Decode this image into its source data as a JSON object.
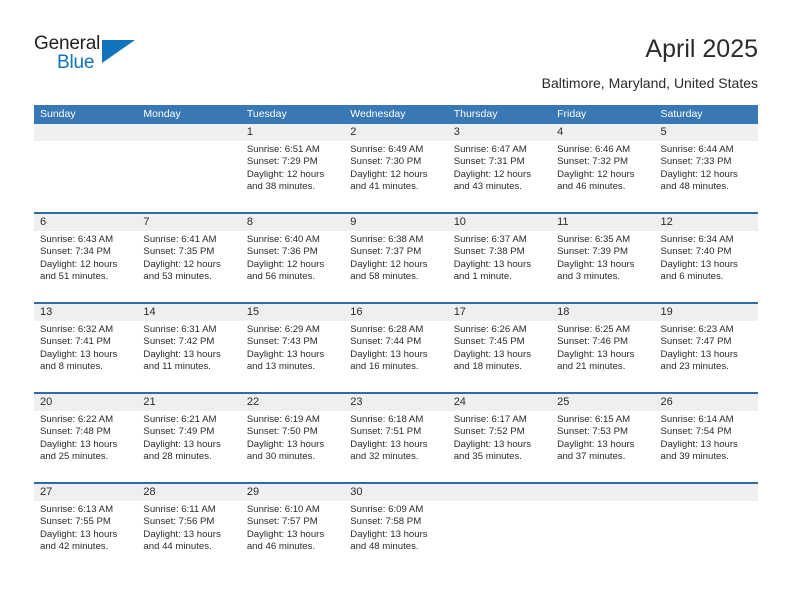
{
  "brand": {
    "name_part1": "General",
    "name_part2": "Blue",
    "accent_color": "#1273bd",
    "logo_icon": "triangle-logo-icon"
  },
  "header": {
    "title": "April 2025",
    "subtitle": "Baltimore, Maryland, United States"
  },
  "calendar": {
    "header_color": "#3878b4",
    "row_divider_color": "#2b6cab",
    "day_band_color": "#efefef",
    "weekdays": [
      "Sunday",
      "Monday",
      "Tuesday",
      "Wednesday",
      "Thursday",
      "Friday",
      "Saturday"
    ],
    "weeks": [
      [
        {
          "day": "",
          "empty": true,
          "sunrise": "",
          "sunset": "",
          "daylight_line1": "",
          "daylight_line2": ""
        },
        {
          "day": "",
          "empty": true,
          "sunrise": "",
          "sunset": "",
          "daylight_line1": "",
          "daylight_line2": ""
        },
        {
          "day": "1",
          "empty": false,
          "sunrise": "Sunrise: 6:51 AM",
          "sunset": "Sunset: 7:29 PM",
          "daylight_line1": "Daylight: 12 hours",
          "daylight_line2": "and 38 minutes."
        },
        {
          "day": "2",
          "empty": false,
          "sunrise": "Sunrise: 6:49 AM",
          "sunset": "Sunset: 7:30 PM",
          "daylight_line1": "Daylight: 12 hours",
          "daylight_line2": "and 41 minutes."
        },
        {
          "day": "3",
          "empty": false,
          "sunrise": "Sunrise: 6:47 AM",
          "sunset": "Sunset: 7:31 PM",
          "daylight_line1": "Daylight: 12 hours",
          "daylight_line2": "and 43 minutes."
        },
        {
          "day": "4",
          "empty": false,
          "sunrise": "Sunrise: 6:46 AM",
          "sunset": "Sunset: 7:32 PM",
          "daylight_line1": "Daylight: 12 hours",
          "daylight_line2": "and 46 minutes."
        },
        {
          "day": "5",
          "empty": false,
          "sunrise": "Sunrise: 6:44 AM",
          "sunset": "Sunset: 7:33 PM",
          "daylight_line1": "Daylight: 12 hours",
          "daylight_line2": "and 48 minutes."
        }
      ],
      [
        {
          "day": "6",
          "empty": false,
          "sunrise": "Sunrise: 6:43 AM",
          "sunset": "Sunset: 7:34 PM",
          "daylight_line1": "Daylight: 12 hours",
          "daylight_line2": "and 51 minutes."
        },
        {
          "day": "7",
          "empty": false,
          "sunrise": "Sunrise: 6:41 AM",
          "sunset": "Sunset: 7:35 PM",
          "daylight_line1": "Daylight: 12 hours",
          "daylight_line2": "and 53 minutes."
        },
        {
          "day": "8",
          "empty": false,
          "sunrise": "Sunrise: 6:40 AM",
          "sunset": "Sunset: 7:36 PM",
          "daylight_line1": "Daylight: 12 hours",
          "daylight_line2": "and 56 minutes."
        },
        {
          "day": "9",
          "empty": false,
          "sunrise": "Sunrise: 6:38 AM",
          "sunset": "Sunset: 7:37 PM",
          "daylight_line1": "Daylight: 12 hours",
          "daylight_line2": "and 58 minutes."
        },
        {
          "day": "10",
          "empty": false,
          "sunrise": "Sunrise: 6:37 AM",
          "sunset": "Sunset: 7:38 PM",
          "daylight_line1": "Daylight: 13 hours",
          "daylight_line2": "and 1 minute."
        },
        {
          "day": "11",
          "empty": false,
          "sunrise": "Sunrise: 6:35 AM",
          "sunset": "Sunset: 7:39 PM",
          "daylight_line1": "Daylight: 13 hours",
          "daylight_line2": "and 3 minutes."
        },
        {
          "day": "12",
          "empty": false,
          "sunrise": "Sunrise: 6:34 AM",
          "sunset": "Sunset: 7:40 PM",
          "daylight_line1": "Daylight: 13 hours",
          "daylight_line2": "and 6 minutes."
        }
      ],
      [
        {
          "day": "13",
          "empty": false,
          "sunrise": "Sunrise: 6:32 AM",
          "sunset": "Sunset: 7:41 PM",
          "daylight_line1": "Daylight: 13 hours",
          "daylight_line2": "and 8 minutes."
        },
        {
          "day": "14",
          "empty": false,
          "sunrise": "Sunrise: 6:31 AM",
          "sunset": "Sunset: 7:42 PM",
          "daylight_line1": "Daylight: 13 hours",
          "daylight_line2": "and 11 minutes."
        },
        {
          "day": "15",
          "empty": false,
          "sunrise": "Sunrise: 6:29 AM",
          "sunset": "Sunset: 7:43 PM",
          "daylight_line1": "Daylight: 13 hours",
          "daylight_line2": "and 13 minutes."
        },
        {
          "day": "16",
          "empty": false,
          "sunrise": "Sunrise: 6:28 AM",
          "sunset": "Sunset: 7:44 PM",
          "daylight_line1": "Daylight: 13 hours",
          "daylight_line2": "and 16 minutes."
        },
        {
          "day": "17",
          "empty": false,
          "sunrise": "Sunrise: 6:26 AM",
          "sunset": "Sunset: 7:45 PM",
          "daylight_line1": "Daylight: 13 hours",
          "daylight_line2": "and 18 minutes."
        },
        {
          "day": "18",
          "empty": false,
          "sunrise": "Sunrise: 6:25 AM",
          "sunset": "Sunset: 7:46 PM",
          "daylight_line1": "Daylight: 13 hours",
          "daylight_line2": "and 21 minutes."
        },
        {
          "day": "19",
          "empty": false,
          "sunrise": "Sunrise: 6:23 AM",
          "sunset": "Sunset: 7:47 PM",
          "daylight_line1": "Daylight: 13 hours",
          "daylight_line2": "and 23 minutes."
        }
      ],
      [
        {
          "day": "20",
          "empty": false,
          "sunrise": "Sunrise: 6:22 AM",
          "sunset": "Sunset: 7:48 PM",
          "daylight_line1": "Daylight: 13 hours",
          "daylight_line2": "and 25 minutes."
        },
        {
          "day": "21",
          "empty": false,
          "sunrise": "Sunrise: 6:21 AM",
          "sunset": "Sunset: 7:49 PM",
          "daylight_line1": "Daylight: 13 hours",
          "daylight_line2": "and 28 minutes."
        },
        {
          "day": "22",
          "empty": false,
          "sunrise": "Sunrise: 6:19 AM",
          "sunset": "Sunset: 7:50 PM",
          "daylight_line1": "Daylight: 13 hours",
          "daylight_line2": "and 30 minutes."
        },
        {
          "day": "23",
          "empty": false,
          "sunrise": "Sunrise: 6:18 AM",
          "sunset": "Sunset: 7:51 PM",
          "daylight_line1": "Daylight: 13 hours",
          "daylight_line2": "and 32 minutes."
        },
        {
          "day": "24",
          "empty": false,
          "sunrise": "Sunrise: 6:17 AM",
          "sunset": "Sunset: 7:52 PM",
          "daylight_line1": "Daylight: 13 hours",
          "daylight_line2": "and 35 minutes."
        },
        {
          "day": "25",
          "empty": false,
          "sunrise": "Sunrise: 6:15 AM",
          "sunset": "Sunset: 7:53 PM",
          "daylight_line1": "Daylight: 13 hours",
          "daylight_line2": "and 37 minutes."
        },
        {
          "day": "26",
          "empty": false,
          "sunrise": "Sunrise: 6:14 AM",
          "sunset": "Sunset: 7:54 PM",
          "daylight_line1": "Daylight: 13 hours",
          "daylight_line2": "and 39 minutes."
        }
      ],
      [
        {
          "day": "27",
          "empty": false,
          "sunrise": "Sunrise: 6:13 AM",
          "sunset": "Sunset: 7:55 PM",
          "daylight_line1": "Daylight: 13 hours",
          "daylight_line2": "and 42 minutes."
        },
        {
          "day": "28",
          "empty": false,
          "sunrise": "Sunrise: 6:11 AM",
          "sunset": "Sunset: 7:56 PM",
          "daylight_line1": "Daylight: 13 hours",
          "daylight_line2": "and 44 minutes."
        },
        {
          "day": "29",
          "empty": false,
          "sunrise": "Sunrise: 6:10 AM",
          "sunset": "Sunset: 7:57 PM",
          "daylight_line1": "Daylight: 13 hours",
          "daylight_line2": "and 46 minutes."
        },
        {
          "day": "30",
          "empty": false,
          "sunrise": "Sunrise: 6:09 AM",
          "sunset": "Sunset: 7:58 PM",
          "daylight_line1": "Daylight: 13 hours",
          "daylight_line2": "and 48 minutes."
        },
        {
          "day": "",
          "empty": true,
          "sunrise": "",
          "sunset": "",
          "daylight_line1": "",
          "daylight_line2": ""
        },
        {
          "day": "",
          "empty": true,
          "sunrise": "",
          "sunset": "",
          "daylight_line1": "",
          "daylight_line2": ""
        },
        {
          "day": "",
          "empty": true,
          "sunrise": "",
          "sunset": "",
          "daylight_line1": "",
          "daylight_line2": ""
        }
      ]
    ]
  }
}
